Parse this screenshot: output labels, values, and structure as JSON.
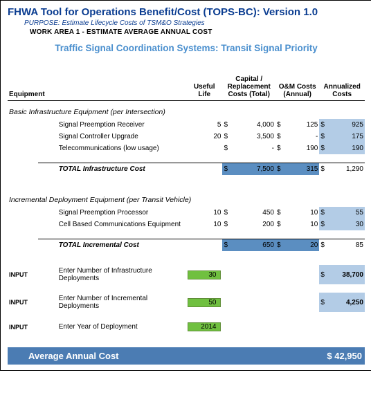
{
  "header": {
    "title": "FHWA Tool for Operations Benefit/Cost (TOPS-BC):  Version 1.0",
    "purpose": "PURPOSE:  Estimate Lifecycle Costs of TSM&O Strategies",
    "workarea": "WORK AREA 1 - ESTIMATE AVERAGE ANNUAL COST",
    "subheader": "Traffic Signal Coordination Systems: Transit Signal Priority"
  },
  "columns": {
    "equipment": "Equipment",
    "useful_life": "Useful Life",
    "capital": "Capital / Replacement Costs (Total)",
    "om": "O&M Costs (Annual)",
    "ann": "Annualized Costs"
  },
  "sections": [
    {
      "title": "Basic Infrastructure Equipment (per Intersection)",
      "rows": [
        {
          "name": "Signal Preemption Receiver",
          "life": "5",
          "cap": "4,000",
          "om": "125",
          "ann": "925"
        },
        {
          "name": "Signal Controller Upgrade",
          "life": "20",
          "cap": "3,500",
          "om": "-",
          "ann": "175"
        },
        {
          "name": "Telecommunications (low usage)",
          "life": "",
          "cap": "-",
          "om": "190",
          "ann": "190"
        }
      ],
      "total": {
        "label": "TOTAL Infrastructure Cost",
        "cap": "7,500",
        "om": "315",
        "ann": "1,290"
      }
    },
    {
      "title": "Incremental Deployment Equipment (per Transit Vehicle)",
      "rows": [
        {
          "name": "Signal Preemption Processor",
          "life": "10",
          "cap": "450",
          "om": "10",
          "ann": "55"
        },
        {
          "name": "Cell Based Communications Equipment",
          "life": "10",
          "cap": "200",
          "om": "10",
          "ann": "30"
        }
      ],
      "total": {
        "label": "TOTAL Incremental Cost",
        "cap": "650",
        "om": "20",
        "ann": "85"
      }
    }
  ],
  "inputs": {
    "label": "INPUT",
    "row1": {
      "text": "Enter Number of Infrastructure Deployments",
      "val": "30",
      "ann": "38,700"
    },
    "row2": {
      "text": "Enter Number of Incremental Deployments",
      "val": "50",
      "ann": "4,250"
    },
    "row3": {
      "text": "Enter Year of Deployment",
      "val": "2014"
    }
  },
  "footer": {
    "label": "Average Annual Cost",
    "value": "$ 42,950"
  },
  "sym": {
    "d": "$"
  }
}
